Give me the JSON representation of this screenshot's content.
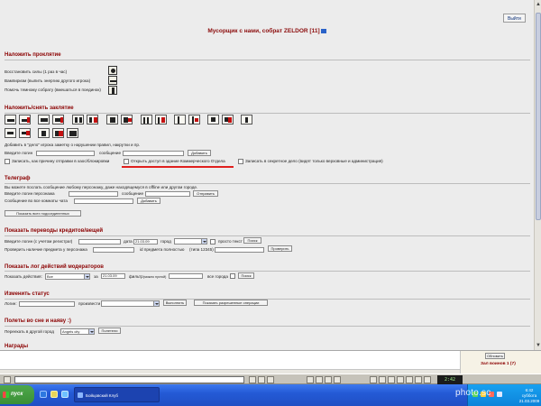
{
  "exit_button": "Выйти",
  "page_title": "Мусорщик с нами, собрат ZELDOR [11]",
  "curse": {
    "heading": "Наложить проклятие",
    "items": [
      "Восстановить силы (1 раз в час)",
      "Вампиризм (выпить энергию другого игрока)",
      "Помочь темному собрату (вмешаться в поединок)"
    ]
  },
  "spells": {
    "heading": "Наложить/снять заклятие",
    "report_text": "Добавить в \"дело\" игрока заметку о нарушении правил, накрутки и пр.",
    "login_label": "Введите логин",
    "message_label": "сообщение",
    "add_button": "Добавить",
    "checkboxes": [
      "Записать, как причину отправки в хаос/блокировки",
      "Открыть доступ в здание Коммерческого Отдела",
      "Записать в секретное дело (видят только верховные и администрация)"
    ]
  },
  "telegraph": {
    "heading": "Телеграф",
    "description": "Вы можете послать сообщение любому персонажу, даже находящемуся в offline или другом городе.",
    "login_label": "Введите логин персонажа",
    "message_label": "сообщение",
    "send_button": "Отправить",
    "chat_label": "Сообщение во все комнаты чата",
    "add_button": "Добавить",
    "show_subscribers_button": "Показать всех подсоединенных"
  },
  "transfers": {
    "heading": "Показать переводы кредитов/вещей",
    "login_label": "Введите логин (с учетом регистра!)",
    "date_label": "дата",
    "date_value": "21.03.09",
    "city_label": "город",
    "simple_text_label": "просто текст",
    "show_button": "Поиск",
    "check_label": "Проверить наличие предмета у персонажа",
    "item_id_label": "id предмета полностью",
    "item_id_hint": "(типа 12345)",
    "check_button": "Проверить"
  },
  "moderators": {
    "heading": "Показать лог действий модераторов",
    "actions_label": "Показать действия:",
    "actions_value": "Все",
    "for_label": "за",
    "date_value": "21.03.09",
    "filter_label": "фильтр",
    "filter_hint": "(можно пустой)",
    "all_cities_label": "все города",
    "show_button": "Поиск"
  },
  "status": {
    "heading": "Изменить статус",
    "login_label": "Логин:",
    "rank_label": "произвести в",
    "do_button": "Выполнить",
    "show_ops_button": "Показать разрешенные операции"
  },
  "travel": {
    "heading": "Полеты во сне и наяву :)",
    "move_label": "Переехать в другой город",
    "city_value": "Angels city",
    "go_button": "Полетели"
  },
  "nagrady_heading": "Награды",
  "side_panel": {
    "refresh_button": "Обновить",
    "title": "Зал воинов 1 (7)"
  },
  "game_clock": "2:42",
  "taskbar": {
    "start_label": "пуск",
    "task_label": "Бойцовский Клуб",
    "time": "6:42",
    "day": "суббота",
    "date": "21.03.2009"
  },
  "watermark": "photo.sc",
  "colors": {
    "section_heading": "#8b0000",
    "highlight_underline": "#e0201e",
    "taskbar": "#245ad6",
    "start": "#3a8f36"
  }
}
